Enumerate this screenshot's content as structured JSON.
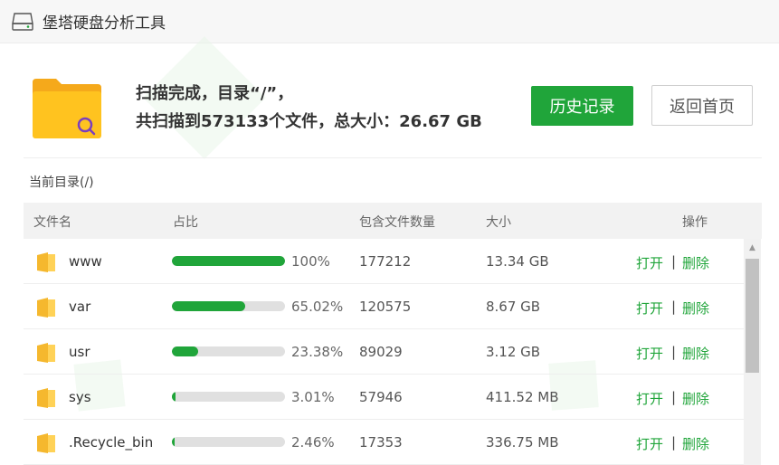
{
  "window": {
    "title": "堡塔硬盘分析工具"
  },
  "summary": {
    "line1": "扫描完成，目录“/”，",
    "line2": "共扫描到573133个文件，总大小：26.67 GB",
    "history_button": "历史记录",
    "back_button": "返回首页"
  },
  "current_dir": "当前目录(/)",
  "table": {
    "headers": {
      "name": "文件名",
      "ratio": "占比",
      "count": "包含文件数量",
      "size": "大小",
      "action": "操作"
    },
    "rows": [
      {
        "name": "www",
        "ratio": 100,
        "ratio_text": "100%",
        "count": "177212",
        "size": "13.34 GB",
        "open": "打开",
        "sep": "|",
        "delete": "删除"
      },
      {
        "name": "var",
        "ratio": 65.02,
        "ratio_text": "65.02%",
        "count": "120575",
        "size": "8.67 GB",
        "open": "打开",
        "sep": "|",
        "delete": "删除"
      },
      {
        "name": "usr",
        "ratio": 23.38,
        "ratio_text": "23.38%",
        "count": "89029",
        "size": "3.12 GB",
        "open": "打开",
        "sep": "|",
        "delete": "删除"
      },
      {
        "name": "sys",
        "ratio": 3.01,
        "ratio_text": "3.01%",
        "count": "57946",
        "size": "411.52 MB",
        "open": "打开",
        "sep": "|",
        "delete": "删除"
      },
      {
        "name": ".Recycle_bin",
        "ratio": 2.46,
        "ratio_text": "2.46%",
        "count": "17353",
        "size": "336.75 MB",
        "open": "打开",
        "sep": "|",
        "delete": "删除"
      }
    ]
  },
  "colors": {
    "accent": "#20a53a",
    "folder": "#ffc31f",
    "bar_track": "#e0e0e0"
  },
  "icons": {
    "app": "hard-disk-icon",
    "summary": "folder-search-icon",
    "row": "folder-icon",
    "scroll": "scroll-up-arrow-icon"
  }
}
